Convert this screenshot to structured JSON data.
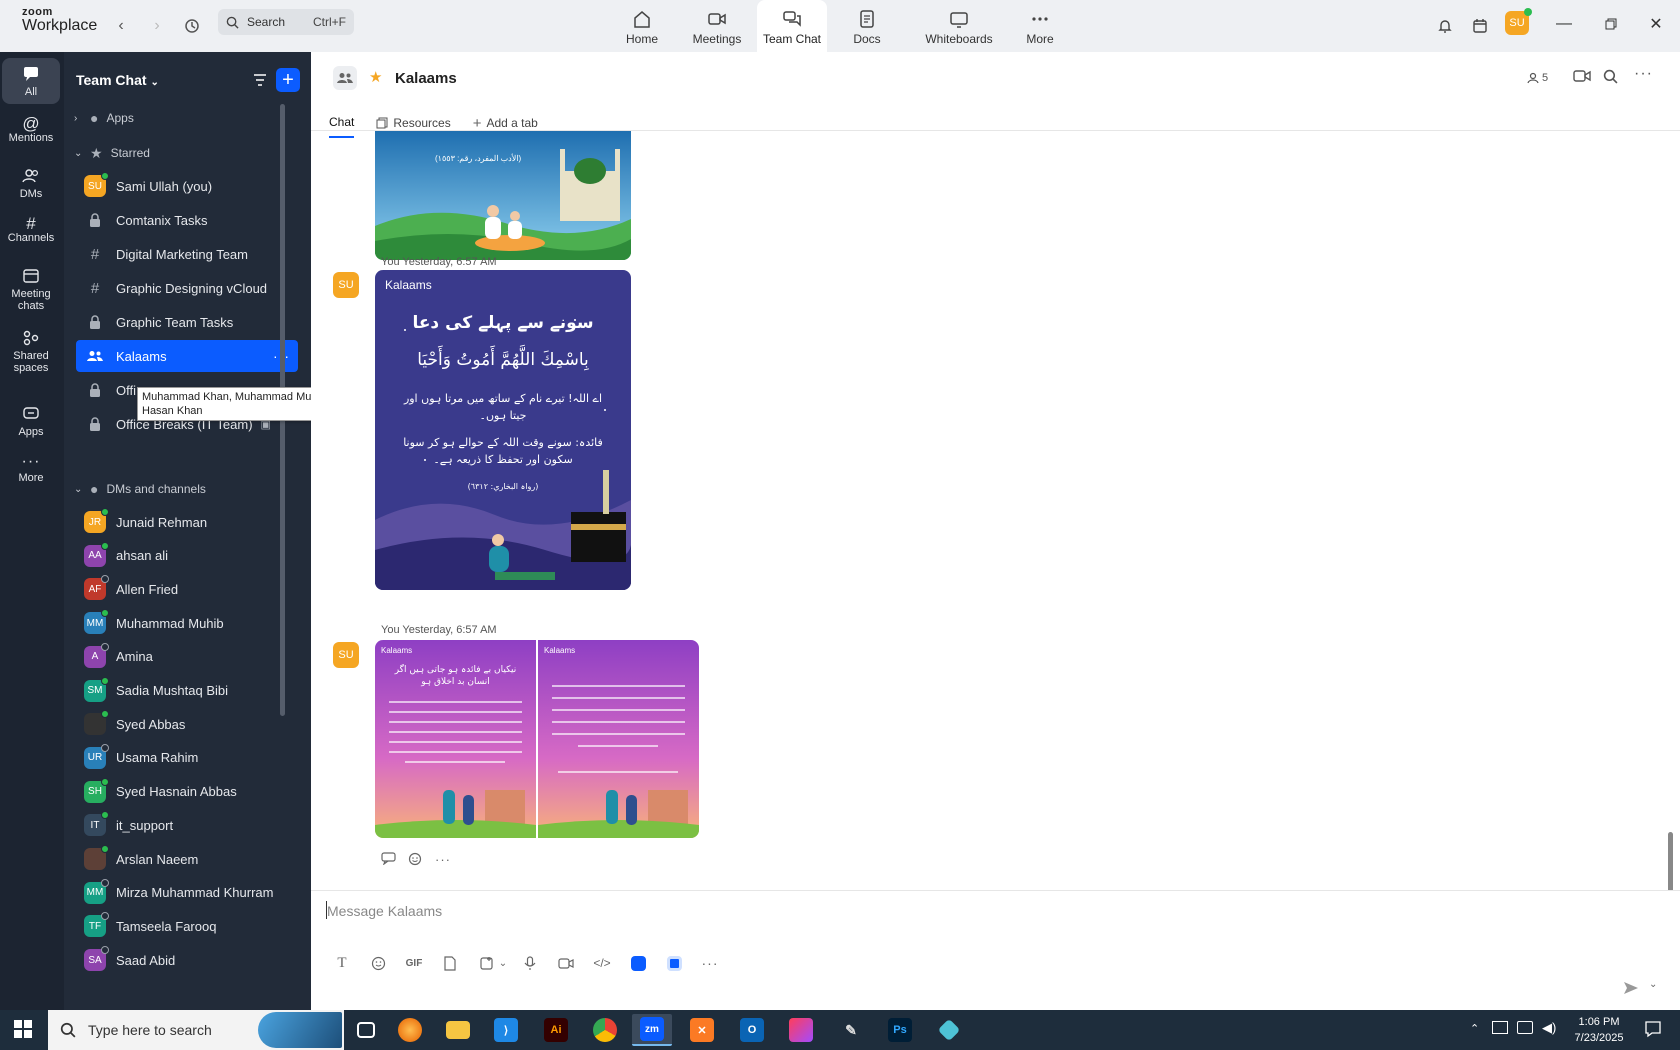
{
  "app": {
    "brand_top": "zoom",
    "brand_bottom": "Workplace"
  },
  "search": {
    "label": "Search",
    "shortcut": "Ctrl+F"
  },
  "nav_tabs": [
    {
      "label": "Home",
      "icon": "home-icon"
    },
    {
      "label": "Meetings",
      "icon": "video-icon"
    },
    {
      "label": "Team Chat",
      "icon": "chat-icon",
      "active": true
    },
    {
      "label": "Docs",
      "icon": "doc-icon"
    },
    {
      "label": "Whiteboards",
      "icon": "whiteboard-icon"
    },
    {
      "label": "More",
      "icon": "more-icon"
    }
  ],
  "user_avatar": "SU",
  "rail": {
    "items": [
      {
        "label": "All",
        "active": true
      },
      {
        "label": "Mentions"
      },
      {
        "label": "DMs"
      },
      {
        "label": "Channels"
      },
      {
        "label": "Meeting chats"
      },
      {
        "label": "Shared spaces"
      },
      {
        "label": "Apps"
      },
      {
        "label": "More"
      }
    ]
  },
  "sidebar": {
    "title": "Team Chat",
    "apps_label": "Apps",
    "starred_label": "Starred",
    "starred": [
      {
        "name": "Sami Ullah (you)",
        "type": "avatar",
        "initials": "SU",
        "color": "#f5a623",
        "status": "online"
      },
      {
        "name": "Comtanix Tasks",
        "type": "lock"
      },
      {
        "name": "Digital Marketing Team",
        "type": "hash"
      },
      {
        "name": "Graphic Designing vCloud",
        "type": "hash"
      },
      {
        "name": "Graphic Team Tasks",
        "type": "lock"
      },
      {
        "name": "Kalaams",
        "type": "group",
        "active": true
      },
      {
        "name": "Offi",
        "type": "lock"
      },
      {
        "name": "Office Breaks (IT Team)",
        "type": "lock"
      }
    ],
    "dms_label": "DMs and channels",
    "dms": [
      {
        "name": "Junaid Rehman",
        "initials": "JR",
        "color": "#f5a623",
        "status": "online"
      },
      {
        "name": "ahsan ali",
        "initials": "AA",
        "color": "#8e44ad",
        "status": "online"
      },
      {
        "name": "Allen Fried",
        "initials": "AF",
        "color": "#c0392b",
        "status": "off"
      },
      {
        "name": "Muhammad Muhib",
        "initials": "MM",
        "color": "#2980b9",
        "status": "online"
      },
      {
        "name": "Amina",
        "initials": "A",
        "color": "#8e44ad",
        "status": "off"
      },
      {
        "name": "Sadia Mushtaq Bibi",
        "initials": "SM",
        "color": "#16a085",
        "status": "online"
      },
      {
        "name": "Syed Abbas",
        "initials": "",
        "color": "#333333",
        "status": "online"
      },
      {
        "name": "Usama Rahim",
        "initials": "UR",
        "color": "#2980b9",
        "status": "off"
      },
      {
        "name": "Syed Hasnain Abbas",
        "initials": "SH",
        "color": "#27ae60",
        "status": "online"
      },
      {
        "name": "it_support",
        "initials": "IT",
        "color": "#34495e",
        "status": "online"
      },
      {
        "name": "Arslan Naeem",
        "initials": "",
        "color": "#5d4037",
        "status": "online"
      },
      {
        "name": "Mirza Muhammad Khurram",
        "initials": "MM",
        "color": "#16a085",
        "status": "off"
      },
      {
        "name": "Tamseela Farooq",
        "initials": "TF",
        "color": "#16a085",
        "status": "off"
      },
      {
        "name": "Saad Abid",
        "initials": "SA",
        "color": "#8e44ad",
        "status": "off"
      }
    ]
  },
  "tooltip": {
    "text": "Muhammad Khan, Muhammad Muhib, Junaid Rehman, Hasan Khan"
  },
  "channel": {
    "name": "Kalaams",
    "member_count": "5",
    "tabs": [
      {
        "label": "Chat",
        "active": true
      },
      {
        "label": "Resources"
      },
      {
        "label": "Add a tab"
      }
    ]
  },
  "messages": [
    {
      "sender": "You",
      "time": "Yesterday, 6:57 AM",
      "avatar": "SU"
    },
    {
      "sender": "You",
      "time": "Yesterday, 6:57 AM",
      "avatar": "SU"
    }
  ],
  "cards": {
    "card1_line": "(الأدب المفرد، رقم: ١٥٥٣)",
    "card2_logo": "Kalaams",
    "card2_title": "سونے سے پہلے کی دعا",
    "card2_arabic": "بِاسْمِكَ اللَّهُمَّ أَمُوتُ وَأَحْيَا",
    "card2_urdu1": "اے اللہ! تیرے نام کے ساتھ میں مرتا ہوں اور جیتا ہوں۔",
    "card2_urdu2": "فائدہ: سونے وقت اللہ کے حوالے ہو کر سونا سکون اور تحفظ کا ذریعہ ہے۔",
    "card2_ref": "(رواہ البخاري: ٦٣١٢)",
    "card3_logo": "Kalaams",
    "card3_title": "نیکیاں بے فائدہ ہو جاتی ہیں اگر انسان بد اخلاق ہو",
    "card4_logo": "Kalaams"
  },
  "composer": {
    "placeholder": "Message Kalaams"
  },
  "taskbar": {
    "search_placeholder": "Type here to search",
    "time": "1:06 PM",
    "date": "7/23/2025"
  }
}
